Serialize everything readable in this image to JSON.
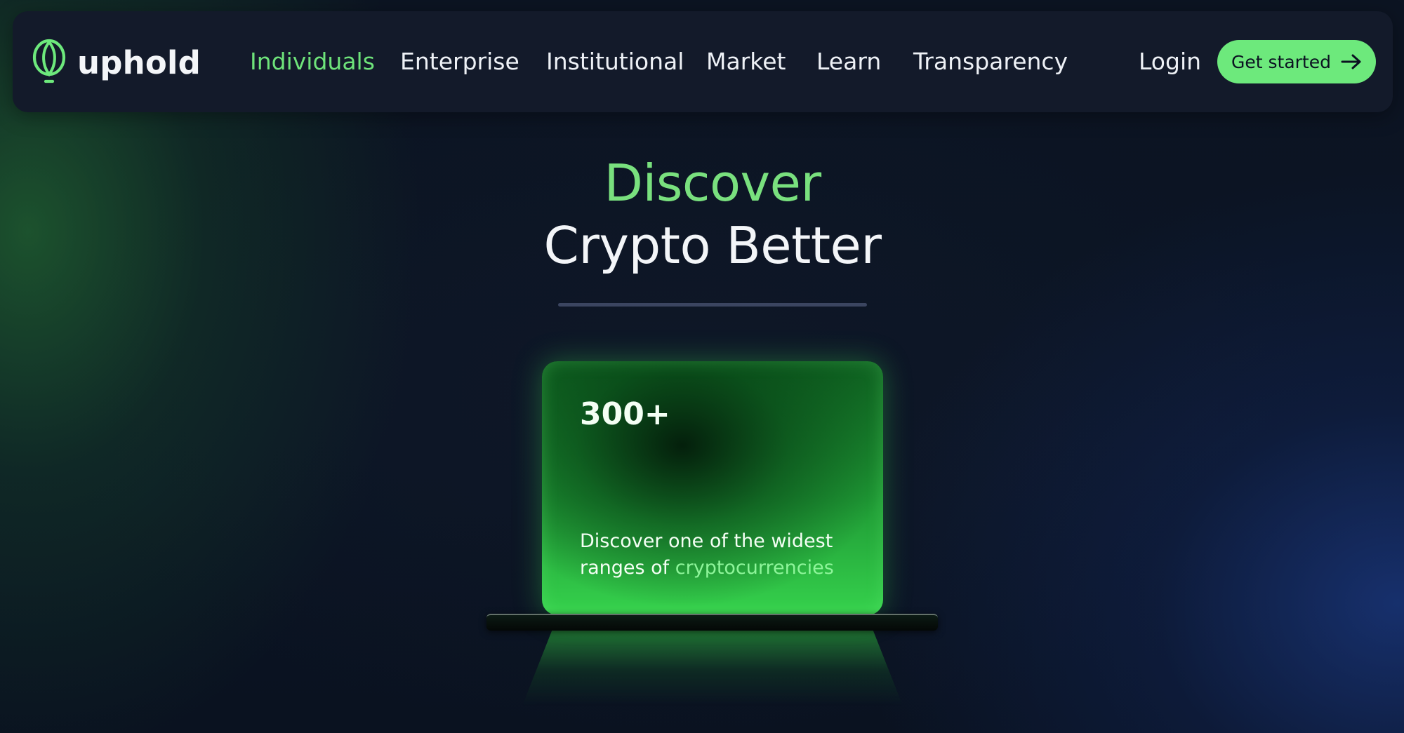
{
  "brand": {
    "name": "uphold",
    "icon": "uphold-logo-icon"
  },
  "nav": {
    "items": [
      {
        "label": "Individuals",
        "active": true
      },
      {
        "label": "Enterprise",
        "active": false
      },
      {
        "label": "Institutional",
        "active": false
      },
      {
        "label": "Market",
        "active": false
      },
      {
        "label": "Learn",
        "active": false
      },
      {
        "label": "Transparency",
        "active": false
      }
    ],
    "login_label": "Login",
    "cta_label": "Get started",
    "cta_icon": "arrow-right-icon"
  },
  "hero": {
    "line1": "Discover",
    "line2": "Crypto Better"
  },
  "card": {
    "stat": "300+",
    "description_prefix": "Discover one of the widest ranges of ",
    "description_highlight": "cryptocurrencies"
  },
  "colors": {
    "accent_green": "#6de97c",
    "page_background": "#0b1221",
    "navbar_background": "#131a2a"
  }
}
